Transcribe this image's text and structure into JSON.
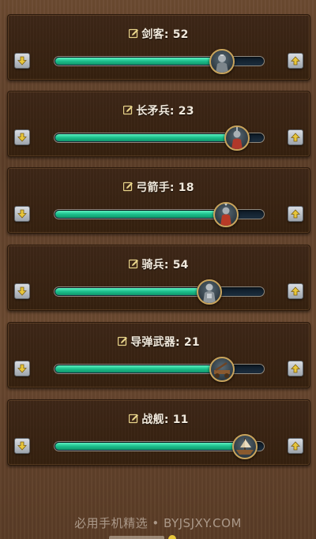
{
  "units": [
    {
      "name": "剑客",
      "count": "52",
      "level": 0.8,
      "thumb_icon": "swordsman-icon"
    },
    {
      "name": "长矛兵",
      "count": "23",
      "level": 0.87,
      "thumb_icon": "spearman-icon"
    },
    {
      "name": "弓箭手",
      "count": "18",
      "level": 0.82,
      "thumb_icon": "archer-icon"
    },
    {
      "name": "骑兵",
      "count": "54",
      "level": 0.74,
      "thumb_icon": "cavalry-icon"
    },
    {
      "name": "导弹武器",
      "count": "21",
      "level": 0.8,
      "thumb_icon": "siege-weapon-icon"
    },
    {
      "name": "战舰",
      "count": "11",
      "level": 0.91,
      "thumb_icon": "warship-icon"
    }
  ],
  "controls": {
    "decrease_icon": "arrow-down-icon",
    "increase_icon": "arrow-up-icon",
    "edit_icon": "edit-pencil-icon"
  },
  "watermark": {
    "text": "必用手机精选 • BYJSJXY.COM"
  },
  "colors": {
    "slider_fill": "#1bbf8c",
    "thumb_ring": "#c9a45c",
    "panel_bg": "#3a2514"
  }
}
